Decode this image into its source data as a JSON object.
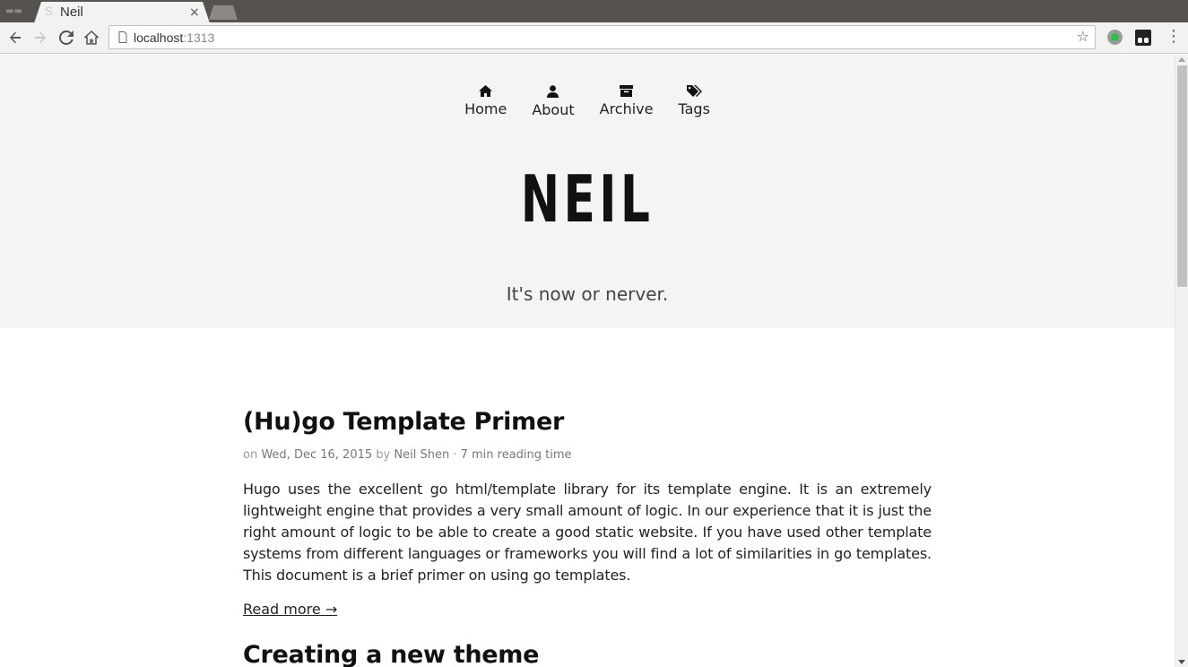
{
  "browser": {
    "tab_title": "Neil",
    "tab_favicon": "S",
    "tab_close": "×",
    "url_host": "localhost",
    "url_port": ":1313",
    "star": "☆",
    "menu": "⋮"
  },
  "nav": {
    "items": [
      {
        "label": "Home",
        "icon": "home-icon"
      },
      {
        "label": "About",
        "icon": "user-icon"
      },
      {
        "label": "Archive",
        "icon": "archive-icon"
      },
      {
        "label": "Tags",
        "icon": "tags-icon"
      }
    ]
  },
  "site": {
    "title": "NEIL",
    "tagline": "It's now or nerver."
  },
  "posts": [
    {
      "title": "(Hu)go Template Primer",
      "meta_on": "on",
      "date": "Wed, Dec 16, 2015",
      "meta_by": "by",
      "author": "Neil Shen",
      "separator": "·",
      "reading_time": "7 min reading time",
      "summary": "Hugo uses the excellent go html/template library for its template engine. It is an extremely lightweight engine that provides a very small amount of logic. In our experience that it is just the right amount of logic to be able to create a good static website. If you have used other template systems from different languages or frameworks you will find a lot of similarities in go templates. This document is a brief primer on using go templates.",
      "read_more": "Read more →"
    },
    {
      "title": "Creating a new theme"
    }
  ],
  "colors": {
    "header_bg": "#f4f4f4",
    "tabstrip_bg": "#56524d",
    "toolbar_bg": "#f2f2f2"
  }
}
